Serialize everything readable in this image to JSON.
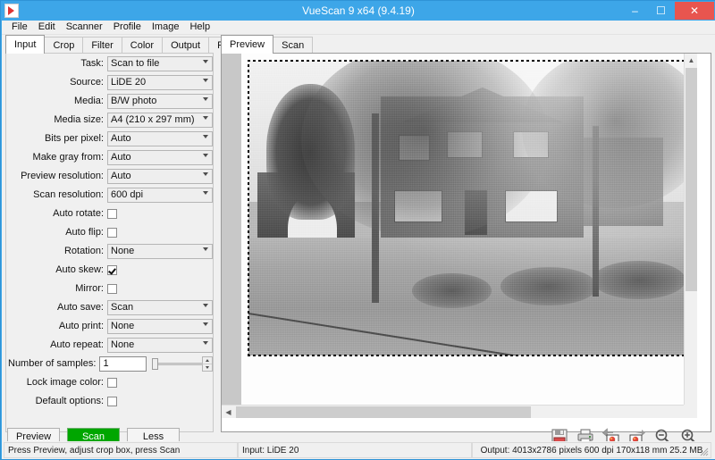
{
  "window": {
    "title": "VueScan 9 x64 (9.4.19)",
    "icon": "vuescan-logo-icon",
    "minimize_label": "–",
    "maximize_label": "☐",
    "close_label": "✕",
    "accent_color": "#3da6e8",
    "close_color": "#e8554f"
  },
  "menubar": {
    "items": [
      {
        "label": "File"
      },
      {
        "label": "Edit"
      },
      {
        "label": "Scanner"
      },
      {
        "label": "Profile"
      },
      {
        "label": "Image"
      },
      {
        "label": "Help"
      }
    ]
  },
  "left_panel": {
    "tabs": [
      {
        "label": "Input",
        "active": true
      },
      {
        "label": "Crop",
        "active": false
      },
      {
        "label": "Filter",
        "active": false
      },
      {
        "label": "Color",
        "active": false
      },
      {
        "label": "Output",
        "active": false
      },
      {
        "label": "Prefs",
        "active": false
      }
    ],
    "fields": [
      {
        "label": "Task:",
        "value": "Scan to file",
        "type": "select"
      },
      {
        "label": "Source:",
        "value": "LiDE 20",
        "type": "select"
      },
      {
        "label": "Media:",
        "value": "B/W photo",
        "type": "select"
      },
      {
        "label": "Media size:",
        "value": "A4 (210 x 297 mm)",
        "type": "select"
      },
      {
        "label": "Bits per pixel:",
        "value": "Auto",
        "type": "select"
      },
      {
        "label": "Make gray from:",
        "value": "Auto",
        "type": "select"
      },
      {
        "label": "Preview resolution:",
        "value": "Auto",
        "type": "select"
      },
      {
        "label": "Scan resolution:",
        "value": "600 dpi",
        "type": "select"
      },
      {
        "label": "Auto rotate:",
        "value": "",
        "type": "checkbox",
        "checked": false
      },
      {
        "label": "Auto flip:",
        "value": "",
        "type": "checkbox",
        "checked": false
      },
      {
        "label": "Rotation:",
        "value": "None",
        "type": "select"
      },
      {
        "label": "Auto skew:",
        "value": "",
        "type": "checkbox",
        "checked": true
      },
      {
        "label": "Mirror:",
        "value": "",
        "type": "checkbox",
        "checked": false
      },
      {
        "label": "Auto save:",
        "value": "Scan",
        "type": "select"
      },
      {
        "label": "Auto print:",
        "value": "None",
        "type": "select"
      },
      {
        "label": "Auto repeat:",
        "value": "None",
        "type": "select"
      },
      {
        "label": "Number of samples:",
        "value": "1",
        "type": "spinner"
      },
      {
        "label": "Lock image color:",
        "value": "",
        "type": "checkbox",
        "checked": false
      },
      {
        "label": "Default options:",
        "value": "",
        "type": "checkbox",
        "checked": false
      }
    ],
    "buttons": [
      {
        "label": "Preview",
        "style": "normal"
      },
      {
        "label": "Scan",
        "style": "green"
      },
      {
        "label": "Less",
        "style": "normal"
      }
    ],
    "scan_button_color": "#00a600"
  },
  "preview_panel": {
    "tabs": [
      {
        "label": "Preview",
        "active": true
      },
      {
        "label": "Scan",
        "active": false
      }
    ],
    "crop_box": "dotted-marquee-crop-box",
    "image_description": "black-and-white-scanned-photo-of-house"
  },
  "toolbar": {
    "icons": [
      {
        "name": "save-icon"
      },
      {
        "name": "print-icon"
      },
      {
        "name": "rotate-left-icon"
      },
      {
        "name": "rotate-right-icon"
      },
      {
        "name": "zoom-out-icon"
      },
      {
        "name": "zoom-in-icon"
      }
    ]
  },
  "statusbar": {
    "left": "Press Preview, adjust crop box, press Scan",
    "middle": "Input: LiDE 20",
    "right": "Output: 4013x2786 pixels 600 dpi 170x118 mm 25.2 MB"
  }
}
